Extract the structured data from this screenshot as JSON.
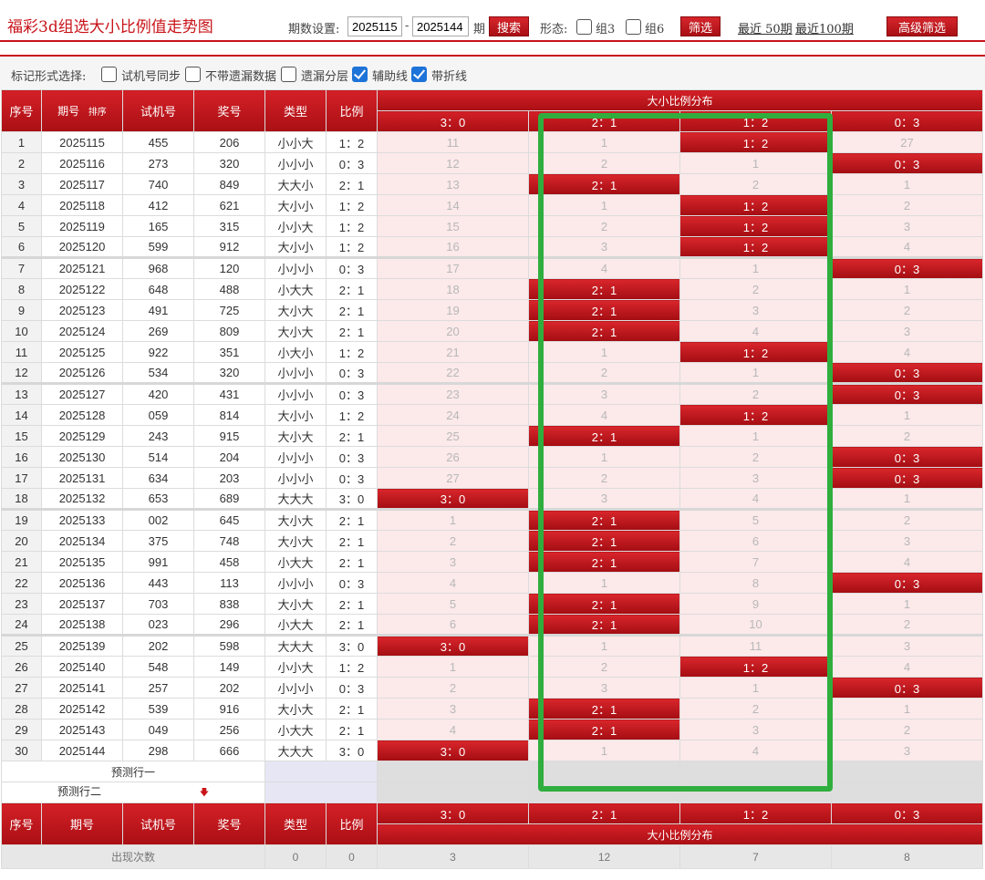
{
  "header": {
    "title": "福彩3d组选大小比例值走势图",
    "period_label": "期数设置:",
    "period_from": "2025115",
    "period_to": "2025144",
    "period_sep": "-",
    "period_unit": "期",
    "search_label": "搜索",
    "form_label": "形态:",
    "group3_label": "组3",
    "group6_label": "组6",
    "filter_label": "筛选",
    "recent50": "最近 50期",
    "recent100": "最近100期",
    "advanced_label": "高级筛选"
  },
  "options": {
    "label": "标记形式选择:",
    "items": [
      {
        "label": "试机号同步",
        "checked": false
      },
      {
        "label": "不带遗漏数据",
        "checked": false
      },
      {
        "label": "遗漏分层",
        "checked": false
      },
      {
        "label": "辅助线",
        "checked": true
      },
      {
        "label": "带折线",
        "checked": true
      }
    ]
  },
  "table": {
    "headers": {
      "idx": "序号",
      "issue": "期号",
      "sort": "排序",
      "test": "试机号",
      "draw": "奖号",
      "type": "类型",
      "ratio": "比例",
      "dist_group": "大小比例分布",
      "dist_cols": [
        "3：0",
        "2：1",
        "1：2",
        "0：3"
      ]
    },
    "rows": [
      {
        "idx": "1",
        "issue": "2025115",
        "test": "455",
        "draw": "206",
        "type": "小小大",
        "ratio": "1：2",
        "dist": [
          "11",
          "1",
          "1：2",
          "27"
        ],
        "hit": 2
      },
      {
        "idx": "2",
        "issue": "2025116",
        "test": "273",
        "draw": "320",
        "type": "小小小",
        "ratio": "0：3",
        "dist": [
          "12",
          "2",
          "1",
          "0：3"
        ],
        "hit": 3
      },
      {
        "idx": "3",
        "issue": "2025117",
        "test": "740",
        "draw": "849",
        "type": "大大小",
        "ratio": "2：1",
        "dist": [
          "13",
          "2：1",
          "2",
          "1"
        ],
        "hit": 1
      },
      {
        "idx": "4",
        "issue": "2025118",
        "test": "412",
        "draw": "621",
        "type": "大小小",
        "ratio": "1：2",
        "dist": [
          "14",
          "1",
          "1：2",
          "2"
        ],
        "hit": 2
      },
      {
        "idx": "5",
        "issue": "2025119",
        "test": "165",
        "draw": "315",
        "type": "小小大",
        "ratio": "1：2",
        "dist": [
          "15",
          "2",
          "1：2",
          "3"
        ],
        "hit": 2
      },
      {
        "idx": "6",
        "issue": "2025120",
        "test": "599",
        "draw": "912",
        "type": "大小小",
        "ratio": "1：2",
        "dist": [
          "16",
          "3",
          "1：2",
          "4"
        ],
        "hit": 2
      },
      {
        "idx": "7",
        "issue": "2025121",
        "test": "968",
        "draw": "120",
        "type": "小小小",
        "ratio": "0：3",
        "dist": [
          "17",
          "4",
          "1",
          "0：3"
        ],
        "hit": 3
      },
      {
        "idx": "8",
        "issue": "2025122",
        "test": "648",
        "draw": "488",
        "type": "小大大",
        "ratio": "2：1",
        "dist": [
          "18",
          "2：1",
          "2",
          "1"
        ],
        "hit": 1
      },
      {
        "idx": "9",
        "issue": "2025123",
        "test": "491",
        "draw": "725",
        "type": "大小大",
        "ratio": "2：1",
        "dist": [
          "19",
          "2：1",
          "3",
          "2"
        ],
        "hit": 1
      },
      {
        "idx": "10",
        "issue": "2025124",
        "test": "269",
        "draw": "809",
        "type": "大小大",
        "ratio": "2：1",
        "dist": [
          "20",
          "2：1",
          "4",
          "3"
        ],
        "hit": 1
      },
      {
        "idx": "11",
        "issue": "2025125",
        "test": "922",
        "draw": "351",
        "type": "小大小",
        "ratio": "1：2",
        "dist": [
          "21",
          "1",
          "1：2",
          "4"
        ],
        "hit": 2
      },
      {
        "idx": "12",
        "issue": "2025126",
        "test": "534",
        "draw": "320",
        "type": "小小小",
        "ratio": "0：3",
        "dist": [
          "22",
          "2",
          "1",
          "0：3"
        ],
        "hit": 3
      },
      {
        "idx": "13",
        "issue": "2025127",
        "test": "420",
        "draw": "431",
        "type": "小小小",
        "ratio": "0：3",
        "dist": [
          "23",
          "3",
          "2",
          "0：3"
        ],
        "hit": 3
      },
      {
        "idx": "14",
        "issue": "2025128",
        "test": "059",
        "draw": "814",
        "type": "大小小",
        "ratio": "1：2",
        "dist": [
          "24",
          "4",
          "1：2",
          "1"
        ],
        "hit": 2
      },
      {
        "idx": "15",
        "issue": "2025129",
        "test": "243",
        "draw": "915",
        "type": "大小大",
        "ratio": "2：1",
        "dist": [
          "25",
          "2：1",
          "1",
          "2"
        ],
        "hit": 1
      },
      {
        "idx": "16",
        "issue": "2025130",
        "test": "514",
        "draw": "204",
        "type": "小小小",
        "ratio": "0：3",
        "dist": [
          "26",
          "1",
          "2",
          "0：3"
        ],
        "hit": 3
      },
      {
        "idx": "17",
        "issue": "2025131",
        "test": "634",
        "draw": "203",
        "type": "小小小",
        "ratio": "0：3",
        "dist": [
          "27",
          "2",
          "3",
          "0：3"
        ],
        "hit": 3
      },
      {
        "idx": "18",
        "issue": "2025132",
        "test": "653",
        "draw": "689",
        "type": "大大大",
        "ratio": "3：0",
        "dist": [
          "3：0",
          "3",
          "4",
          "1"
        ],
        "hit": 0
      },
      {
        "idx": "19",
        "issue": "2025133",
        "test": "002",
        "draw": "645",
        "type": "大小大",
        "ratio": "2：1",
        "dist": [
          "1",
          "2：1",
          "5",
          "2"
        ],
        "hit": 1
      },
      {
        "idx": "20",
        "issue": "2025134",
        "test": "375",
        "draw": "748",
        "type": "大小大",
        "ratio": "2：1",
        "dist": [
          "2",
          "2：1",
          "6",
          "3"
        ],
        "hit": 1
      },
      {
        "idx": "21",
        "issue": "2025135",
        "test": "991",
        "draw": "458",
        "type": "小大大",
        "ratio": "2：1",
        "dist": [
          "3",
          "2：1",
          "7",
          "4"
        ],
        "hit": 1
      },
      {
        "idx": "22",
        "issue": "2025136",
        "test": "443",
        "draw": "113",
        "type": "小小小",
        "ratio": "0：3",
        "dist": [
          "4",
          "1",
          "8",
          "0：3"
        ],
        "hit": 3
      },
      {
        "idx": "23",
        "issue": "2025137",
        "test": "703",
        "draw": "838",
        "type": "大小大",
        "ratio": "2：1",
        "dist": [
          "5",
          "2：1",
          "9",
          "1"
        ],
        "hit": 1
      },
      {
        "idx": "24",
        "issue": "2025138",
        "test": "023",
        "draw": "296",
        "type": "小大大",
        "ratio": "2：1",
        "dist": [
          "6",
          "2：1",
          "10",
          "2"
        ],
        "hit": 1
      },
      {
        "idx": "25",
        "issue": "2025139",
        "test": "202",
        "draw": "598",
        "type": "大大大",
        "ratio": "3：0",
        "dist": [
          "3：0",
          "1",
          "11",
          "3"
        ],
        "hit": 0
      },
      {
        "idx": "26",
        "issue": "2025140",
        "test": "548",
        "draw": "149",
        "type": "小小大",
        "ratio": "1：2",
        "dist": [
          "1",
          "2",
          "1：2",
          "4"
        ],
        "hit": 2
      },
      {
        "idx": "27",
        "issue": "2025141",
        "test": "257",
        "draw": "202",
        "type": "小小小",
        "ratio": "0：3",
        "dist": [
          "2",
          "3",
          "1",
          "0：3"
        ],
        "hit": 3
      },
      {
        "idx": "28",
        "issue": "2025142",
        "test": "539",
        "draw": "916",
        "type": "大小大",
        "ratio": "2：1",
        "dist": [
          "3",
          "2：1",
          "2",
          "1"
        ],
        "hit": 1
      },
      {
        "idx": "29",
        "issue": "2025143",
        "test": "049",
        "draw": "256",
        "type": "小大大",
        "ratio": "2：1",
        "dist": [
          "4",
          "2：1",
          "3",
          "2"
        ],
        "hit": 1
      },
      {
        "idx": "30",
        "issue": "2025144",
        "test": "298",
        "draw": "666",
        "type": "大大大",
        "ratio": "3：0",
        "dist": [
          "3：0",
          "1",
          "4",
          "3"
        ],
        "hit": 0
      }
    ],
    "pred1": "预测行一",
    "pred2": "预测行二",
    "count_label": "出现次数",
    "counts": [
      "0",
      "0",
      "3",
      "12",
      "7",
      "8"
    ]
  },
  "colors": {
    "accent": "#c8141a",
    "hit": "#b3151a",
    "highlight_box": "#2fae3e",
    "dist_bg": "#fce9ea"
  }
}
